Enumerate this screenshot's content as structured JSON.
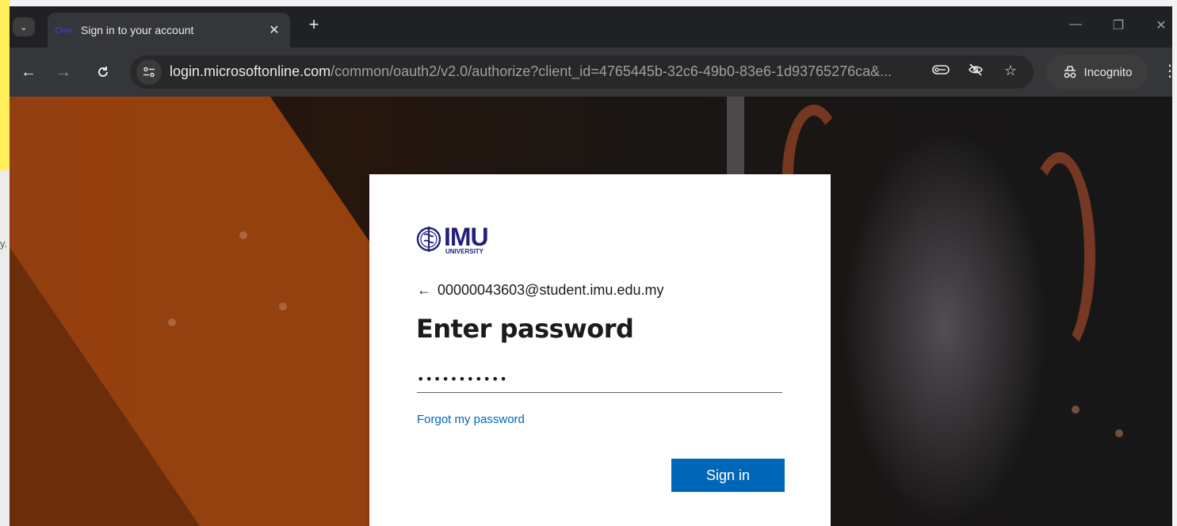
{
  "left_strip": {
    "fragment_text": "y."
  },
  "browser": {
    "tab": {
      "title": "Sign in to your account",
      "favicon": "IMU-logo-icon",
      "close": "✕"
    },
    "new_tab": "+",
    "window_controls": {
      "minimize": "—",
      "restore": "❐",
      "close": "✕"
    },
    "toolbar": {
      "back": "←",
      "forward": "→",
      "reload": "C",
      "url_host": "login.microsoftonline.com",
      "url_path": "/common/oauth2/v2.0/authorize?client_id=4765445b-32c6-49b0-83e6-1d93765276ca&...",
      "incognito_label": "Incognito",
      "icons": [
        "key-icon",
        "eye-off-icon",
        "star-icon"
      ]
    }
  },
  "signin": {
    "logo_text": "IMU",
    "logo_subtext": "UNIVERSITY",
    "back_arrow": "←",
    "identity": "00000043603@student.imu.edu.my",
    "heading": "Enter password",
    "password_value": "•••••••••••",
    "forgot_link": "Forgot my password",
    "signin_button": "Sign in"
  },
  "colors": {
    "accent": "#0067b8",
    "brand": "#23207a",
    "orange": "#a24510"
  }
}
